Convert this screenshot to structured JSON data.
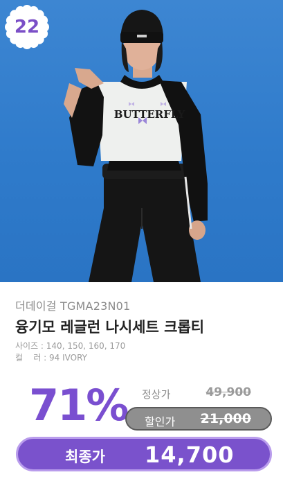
{
  "badge": {
    "number": "22"
  },
  "product": {
    "brand_code": "더데이걸 TGMA23N01",
    "name": "융기모 레글런 나시세트 크롭티",
    "sizes": "사이즈 : 140, 150, 160, 170",
    "color": "컬    러 : 94 IVORY",
    "shirt_print": "BUTTERFLY"
  },
  "pricing": {
    "discount_rate": "71%",
    "regular_label": "정상가",
    "regular_price": "49,900",
    "sale_label": "할인가",
    "sale_price": "21,000",
    "final_label": "최종가",
    "final_price": "14,700"
  },
  "colors": {
    "accent": "#7a52cc",
    "photo_background": "#3582cf"
  }
}
